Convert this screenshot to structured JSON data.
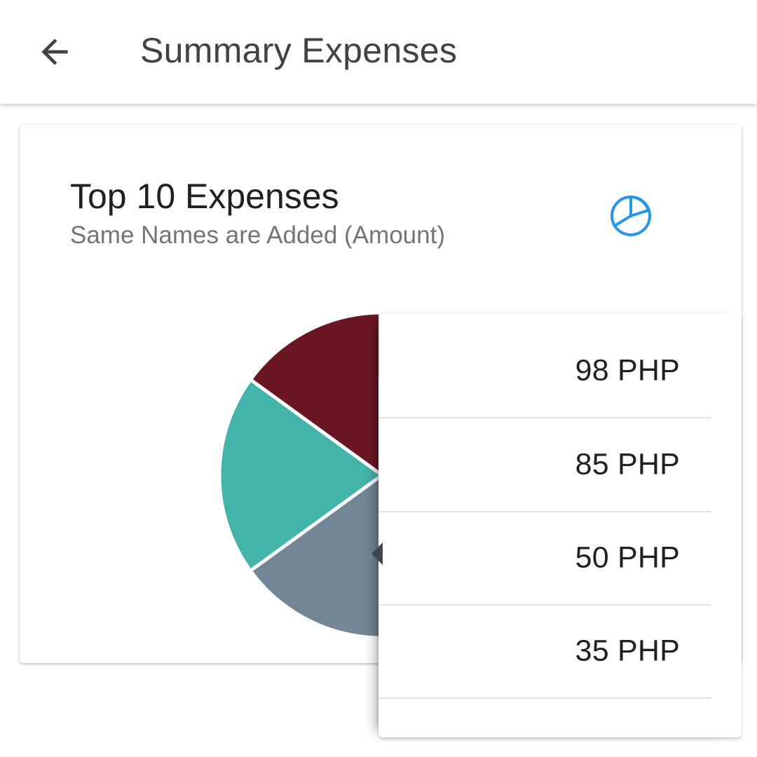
{
  "header": {
    "title": "Summary Expenses",
    "back_icon": "arrow-back-icon"
  },
  "card": {
    "title": "Top 10 Expenses",
    "subtitle": "Same Names are Added (Amount)",
    "toggle_icon": "pie-chart-icon",
    "accent_color": "#2196f3"
  },
  "list": {
    "rows": [
      {
        "amount": "98 PHP"
      },
      {
        "amount": "85 PHP"
      },
      {
        "amount": "50 PHP"
      },
      {
        "amount": "35 PHP"
      }
    ]
  },
  "chart_data": {
    "type": "pie",
    "title": "Top 10 Expenses",
    "subtitle": "Same Names are Added (Amount)",
    "visible_slices": [
      {
        "color": "#6b1623",
        "percent": 15
      },
      {
        "color": "#42b4aa",
        "percent": 20
      },
      {
        "color": "#738696",
        "percent": 21
      }
    ]
  }
}
